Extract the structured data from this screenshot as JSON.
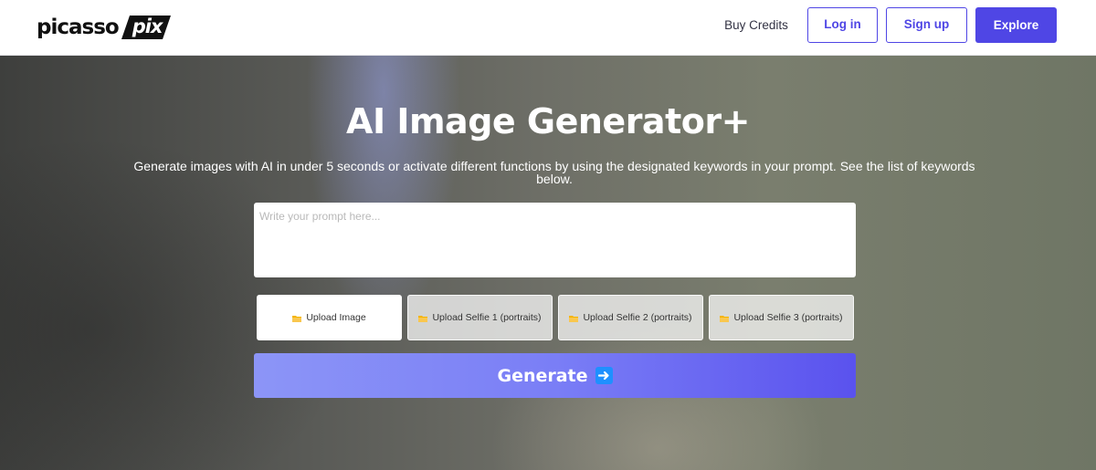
{
  "header": {
    "logo_text": "picasso",
    "logo_badge_text": "pix",
    "buy_credits_label": "Buy Credits",
    "login_label": "Log in",
    "signup_label": "Sign up",
    "explore_label": "Explore"
  },
  "hero": {
    "title": "AI Image Generator+",
    "subtitle": "Generate images with AI in under 5 seconds or activate different functions by using the designated keywords in your prompt. See the list of keywords below.",
    "prompt": {
      "value": "",
      "placeholder": "Write your prompt here..."
    },
    "uploads": [
      {
        "label": "Upload Image",
        "icon": "folder-icon"
      },
      {
        "label": "Upload Selfie 1 (portraits)",
        "icon": "folder-icon"
      },
      {
        "label": "Upload Selfie 2 (portraits)",
        "icon": "folder-icon"
      },
      {
        "label": "Upload Selfie 3 (portraits)",
        "icon": "folder-icon"
      }
    ],
    "generate_label": "Generate",
    "generate_icon": "arrow-right-icon"
  },
  "colors": {
    "accent": "#4f46e5",
    "folder": "#f4b400",
    "arrow_badge": "#1e90ff"
  }
}
